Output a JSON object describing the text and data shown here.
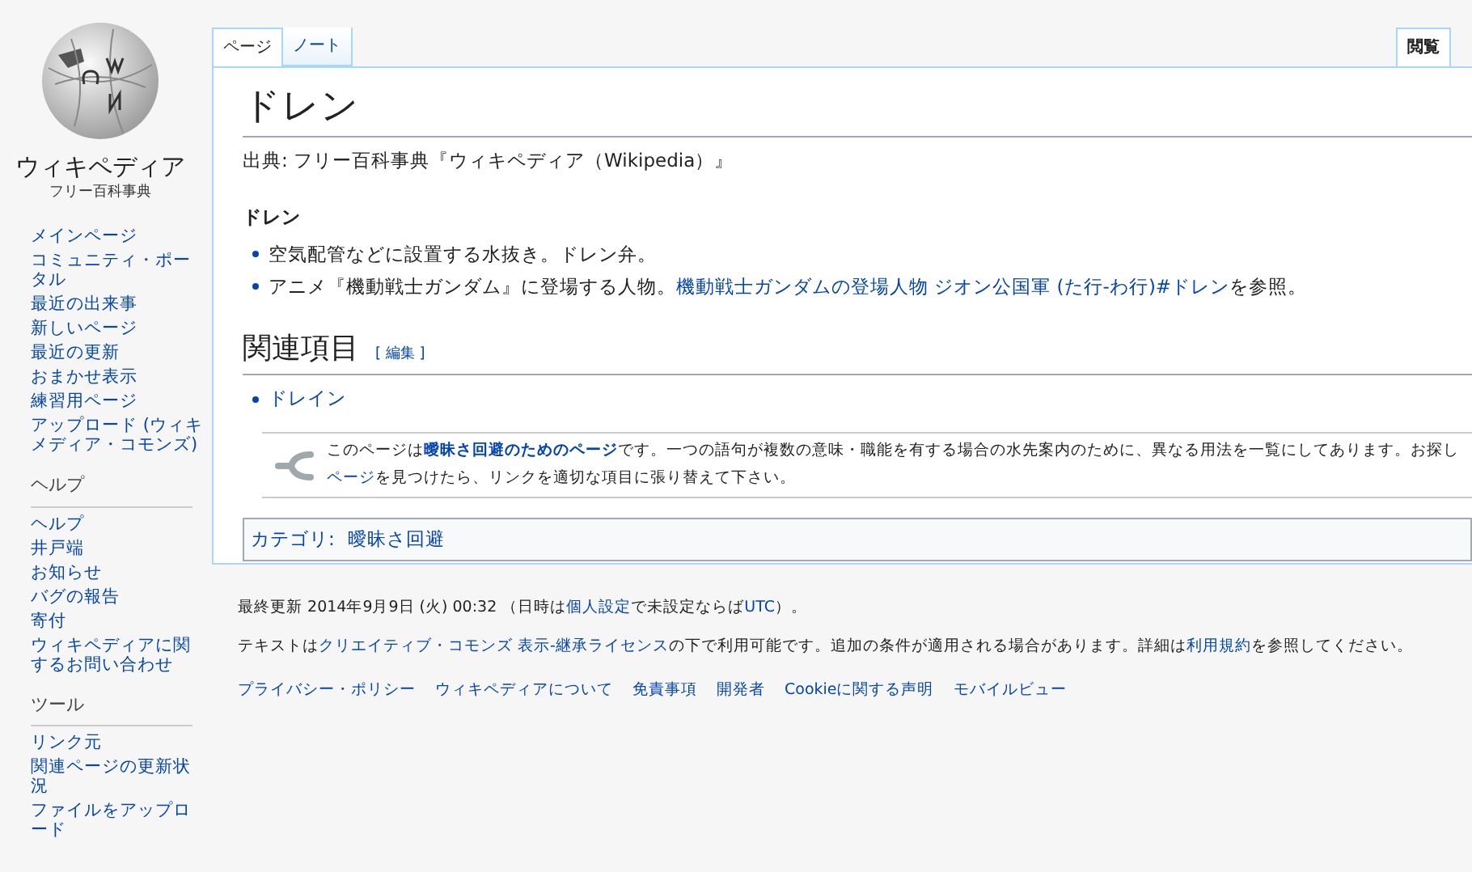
{
  "logo": {
    "wordmark": "ウィキペディア",
    "tagline": "フリー百科事典"
  },
  "sidebar": {
    "sections": [
      {
        "items": [
          "メインページ",
          "コミュニティ・ポータル",
          "最近の出来事",
          "新しいページ",
          "最近の更新",
          "おまかせ表示",
          "練習用ページ",
          "アップロード (ウィキメディア・コモンズ)"
        ]
      },
      {
        "heading": "ヘルプ",
        "items": [
          "ヘルプ",
          "井戸端",
          "お知らせ",
          "バグの報告",
          "寄付",
          "ウィキペディアに関するお問い合わせ"
        ]
      },
      {
        "heading": "ツール",
        "items": [
          "リンク元",
          "関連ページの更新状況",
          "ファイルをアップロード"
        ]
      }
    ]
  },
  "tabs_left": [
    {
      "label": "ページ",
      "selected": true
    },
    {
      "label": "ノート",
      "selected": false
    }
  ],
  "tabs_right": [
    {
      "label": "閲覧",
      "selected": true
    }
  ],
  "article": {
    "title": "ドレン",
    "source": "出典: フリー百科事典『ウィキペディア（Wikipedia）』",
    "term": "ドレン",
    "items": [
      [
        {
          "text": "空気配管などに設置する水抜き。ドレン弁。",
          "link": false
        }
      ],
      [
        {
          "text": "アニメ『機動戦士ガンダム』に登場する人物。",
          "link": false
        },
        {
          "text": "機動戦士ガンダムの登場人物 ジオン公国軍 (た行-わ行)#ドレン",
          "link": true
        },
        {
          "text": "を参照。",
          "link": false
        }
      ]
    ],
    "section": {
      "heading": "関連項目",
      "edit": "[ 編集 ]",
      "items": [
        "ドレイン"
      ]
    },
    "notice": {
      "lines": [
        [
          {
            "text": "このページは",
            "link": false
          },
          {
            "text": "**曖昧さ回避のためのページ**",
            "link": true
          },
          {
            "text": "です。一つの語句が複数の意味・職能を有する場合の水先案内のために、異なる用法を一覧にしてあります。お探し",
            "link": false
          }
        ],
        [
          {
            "text": "ページ",
            "link": true
          },
          {
            "text": "を見つけたら、リンクを適切な項目に張り替えて下さい。",
            "link": false
          }
        ]
      ]
    },
    "category": {
      "label": "カテゴリ:",
      "links": [
        "曖昧さ回避"
      ]
    }
  },
  "footer": {
    "lines": [
      [
        {
          "text": "最終更新 2014年9月9日 (火) 00:32 （日時は",
          "link": false
        },
        {
          "text": "個人設定",
          "link": true
        },
        {
          "text": "で未設定ならば",
          "link": false
        },
        {
          "text": "UTC",
          "link": true
        },
        {
          "text": "）。",
          "link": false
        }
      ],
      [
        {
          "text": "テキストは",
          "link": false
        },
        {
          "text": "クリエイティブ・コモンズ 表示-継承ライセンス",
          "link": true
        },
        {
          "text": "の下で利用可能です。追加の条件が適用される場合があります。詳細は",
          "link": false
        },
        {
          "text": "利用規約",
          "link": true
        },
        {
          "text": "を参照してください。",
          "link": false
        }
      ]
    ],
    "links": [
      "プライバシー・ポリシー",
      "ウィキペディアについて",
      "免責事項",
      "開発者",
      "Cookieに関する声明",
      "モバイルビュー"
    ]
  }
}
